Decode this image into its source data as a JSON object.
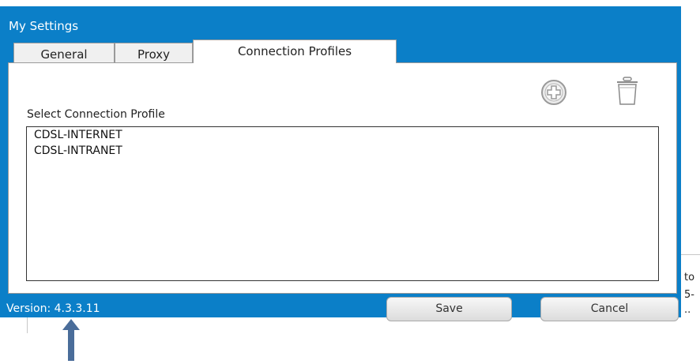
{
  "window": {
    "title": "My Settings"
  },
  "tabs": [
    {
      "label": "General",
      "active": false
    },
    {
      "label": "Proxy",
      "active": false
    },
    {
      "label": "Connection Profiles",
      "active": true
    }
  ],
  "toolbar": {
    "add_icon": "plus-circle-icon",
    "delete_icon": "trash-icon"
  },
  "profiles": {
    "label": "Select Connection Profile",
    "items": [
      "CDSL-INTERNET",
      "CDSL-INTRANET"
    ]
  },
  "footer": {
    "version": "Version: 4.3.3.11",
    "save_label": "Save",
    "cancel_label": "Cancel"
  },
  "background_fragments": [
    "to",
    "5-",
    ".."
  ],
  "colors": {
    "dialog_blue": "#0b7fc8",
    "arrow": "#4a6d9a"
  }
}
